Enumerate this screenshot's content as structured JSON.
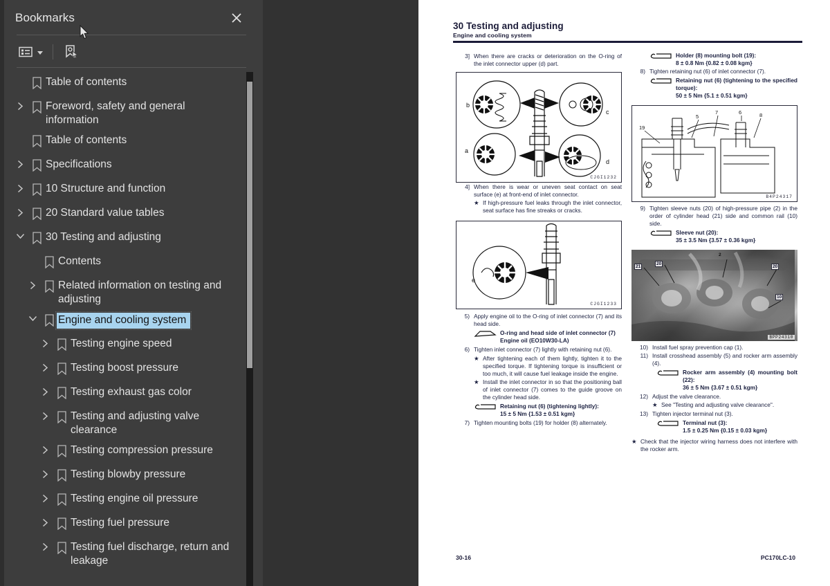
{
  "panel": {
    "title": "Bookmarks",
    "close_label": "×",
    "toolbar": {
      "options_icon": "list-options-icon",
      "options_caret": "chevron-down-icon",
      "new_bookmark_icon": "new-bookmark-icon"
    },
    "collapse_icon": "collapse-panel-arrow-icon",
    "items": [
      {
        "label": "Table of contents",
        "indent": 0,
        "twisty": "none",
        "selected": false
      },
      {
        "label": "Foreword, safety and general information",
        "indent": 0,
        "twisty": "collapsed",
        "selected": false
      },
      {
        "label": "Table of contents",
        "indent": 0,
        "twisty": "none",
        "selected": false
      },
      {
        "label": "Specifications",
        "indent": 0,
        "twisty": "collapsed",
        "selected": false
      },
      {
        "label": "10 Structure and function",
        "indent": 0,
        "twisty": "collapsed",
        "selected": false
      },
      {
        "label": "20 Standard value tables",
        "indent": 0,
        "twisty": "collapsed",
        "selected": false
      },
      {
        "label": "30 Testing and adjusting",
        "indent": 0,
        "twisty": "expanded",
        "selected": false
      },
      {
        "label": "Contents",
        "indent": 1,
        "twisty": "none",
        "selected": false
      },
      {
        "label": "Related information on testing and adjusting",
        "indent": 1,
        "twisty": "collapsed",
        "selected": false
      },
      {
        "label": "Engine and cooling system",
        "indent": 1,
        "twisty": "expanded",
        "selected": true
      },
      {
        "label": "Testing engine speed",
        "indent": 2,
        "twisty": "collapsed",
        "selected": false
      },
      {
        "label": "Testing boost pressure",
        "indent": 2,
        "twisty": "collapsed",
        "selected": false
      },
      {
        "label": "Testing exhaust gas color",
        "indent": 2,
        "twisty": "collapsed",
        "selected": false
      },
      {
        "label": "Testing and adjusting valve clearance",
        "indent": 2,
        "twisty": "collapsed",
        "selected": false
      },
      {
        "label": "Testing compression pressure",
        "indent": 2,
        "twisty": "collapsed",
        "selected": false
      },
      {
        "label": "Testing blowby pressure",
        "indent": 2,
        "twisty": "collapsed",
        "selected": false
      },
      {
        "label": "Testing engine oil pressure",
        "indent": 2,
        "twisty": "collapsed",
        "selected": false
      },
      {
        "label": "Testing fuel pressure",
        "indent": 2,
        "twisty": "collapsed",
        "selected": false
      },
      {
        "label": "Testing fuel discharge, return and leakage",
        "indent": 2,
        "twisty": "collapsed",
        "selected": false
      }
    ]
  },
  "document": {
    "header": {
      "title": "30 Testing and adjusting",
      "subtitle": "Engine and cooling system"
    },
    "footer": {
      "page_number": "30-16",
      "model": "PC170LC-10"
    },
    "left_column": {
      "para_3_num": "3]",
      "para_3_text": "When there are cracks or deterioration on the O-ring of the inlet connector upper (d) part.",
      "figure_1_id": "CJGI1232",
      "figure_1_labels": [
        "b",
        "c",
        "a",
        "d"
      ],
      "para_4_num": "4]",
      "para_4_text": "When there is wear or uneven seat contact on seat surface (e) at front-end of inlet connector.",
      "para_4_star": "If high-pressure fuel leaks through the inlet connector, seat surface has fine streaks or cracks.",
      "figure_2_id": "CJGI1233",
      "figure_2_labels": [
        "e"
      ],
      "step_5_num": "5)",
      "step_5_text": "Apply engine oil to the O-ring of inlet connector (7) and its head side.",
      "step_5_torque_1": "O-ring and head side of inlet connector (7)",
      "step_5_torque_2": "Engine oil (EO10W30-LA)",
      "step_6_num": "6)",
      "step_6_text": "Tighten inlet connector (7) lightly with retaining nut (6).",
      "step_6_star_1": "After tightening each of them lightly, tighten it to the specified torque. If tightening torque is insufficient or too much, it will cause fuel leakage inside the engine.",
      "step_6_star_2": "Install the inlet connector in so that the positioning ball of inlet connector (7) comes to the guide groove on the cylinder head side.",
      "step_6_torque_label": "Retaining nut (6) (tightening lightly):",
      "step_6_torque_value": "15 ± 5 Nm {1.53 ± 0.51 kgm}",
      "step_7_num": "7)",
      "step_7_text": "Tighten mounting bolts (19) for holder (8) alternately."
    },
    "right_column": {
      "torque_1_label": "Holder (8) mounting bolt (19):",
      "torque_1_value": "8 ± 0.8 Nm {0.82 ± 0.08 kgm}",
      "step_8_num": "8)",
      "step_8_text": "Tighten retaining nut (6) of inlet connector (7).",
      "step_8_torque_label": "Retaining nut (6) (tightening to the specified torque):",
      "step_8_torque_value": "50 ± 5 Nm {5.1 ± 0.51 kgm}",
      "figure_3_id": "B4P24317",
      "figure_3_labels": [
        "19",
        "5",
        "7",
        "6"
      ],
      "step_9_num": "9)",
      "step_9_text": "Tighten sleeve nuts (20) of high-pressure pipe (2) in the order of cylinder head (21) side and common rail (10) side.",
      "step_9_torque_label": "Sleeve nut (20):",
      "step_9_torque_value": "35 ± 3.5 Nm {3.57 ± 0.36 kgm}",
      "photo_id": "BPP24310",
      "photo_labels": [
        "21",
        "20",
        "2",
        "20",
        "10"
      ],
      "step_10_num": "10)",
      "step_10_text": "Install fuel spray prevention cap (1).",
      "step_11_num": "11)",
      "step_11_text": "Install crosshead assembly (5) and rocker arm assembly (4).",
      "step_11_torque_label": "Rocker arm assembly (4) mounting bolt (22):",
      "step_11_torque_value": "36 ± 5 Nm {3.67 ± 0.51 kgm}",
      "step_12_num": "12)",
      "step_12_text": "Adjust the valve clearance.",
      "step_12_star": "See \"Testing and adjusting valve clearance\".",
      "step_13_num": "13)",
      "step_13_text": "Tighten injector terminal nut (3).",
      "step_13_torque_label": "Terminal nut (3):",
      "step_13_torque_value": "1.5 ± 0.25 Nm {0.15 ± 0.03 kgm}",
      "final_star": "Check that the injector wiring harness does not interfere with the rocker arm."
    }
  },
  "colors": {
    "panel_bg": "#3d3d3d",
    "viewer_bg": "#323232",
    "selection": "#a8d4ef",
    "page_bg": "#ffffff",
    "text": "#e3e3e3"
  }
}
